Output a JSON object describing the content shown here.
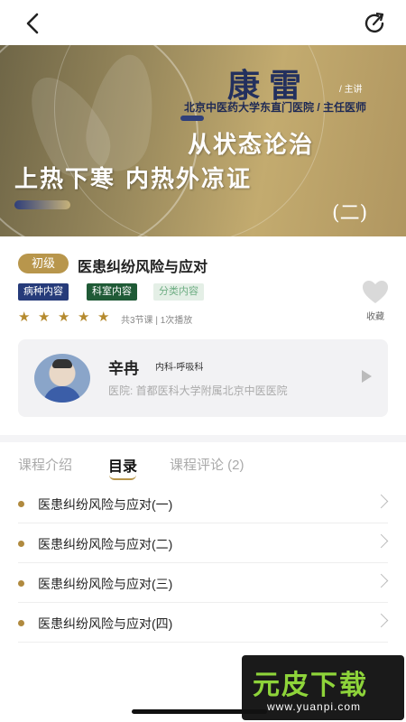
{
  "topbar": {
    "back_icon": "chevron-left-icon",
    "share_icon": "share-icon"
  },
  "banner": {
    "speaker": "康雷",
    "speaker_role": "/ 主讲",
    "hospital": "北京中医药大学东直门医院 / 主任医师",
    "title_line1": "从状态论治",
    "title_line2": "上热下寒 内热外凉证",
    "title_line3": "(二)"
  },
  "course": {
    "level": "初级",
    "title": "医患纠纷风险与应对",
    "tags": [
      "病种内容",
      "科室内容",
      "分类内容"
    ],
    "rating": 5,
    "rating_max": 5,
    "meta": "共3节课 | 1次播放",
    "favorite_label": "收藏"
  },
  "teacher": {
    "name": "辛冉",
    "department": "内科-呼吸科",
    "hospital": "医院:  首都医科大学附属北京中医医院"
  },
  "tabs": [
    {
      "label": "课程介绍",
      "active": false
    },
    {
      "label": "目录",
      "active": true
    },
    {
      "label": "课程评论 (2)",
      "active": false
    }
  ],
  "chapters": [
    "医患纠纷风险与应对(一)",
    "医患纠纷风险与应对(二)",
    "医患纠纷风险与应对(三)",
    "医患纠纷风险与应对(四)"
  ],
  "watermark": {
    "big": "元皮下载",
    "small": "www.yuanpi.com"
  },
  "colors": {
    "accent": "#b8964c",
    "tag_blue": "#263b7a",
    "tag_green": "#1f5a36"
  }
}
